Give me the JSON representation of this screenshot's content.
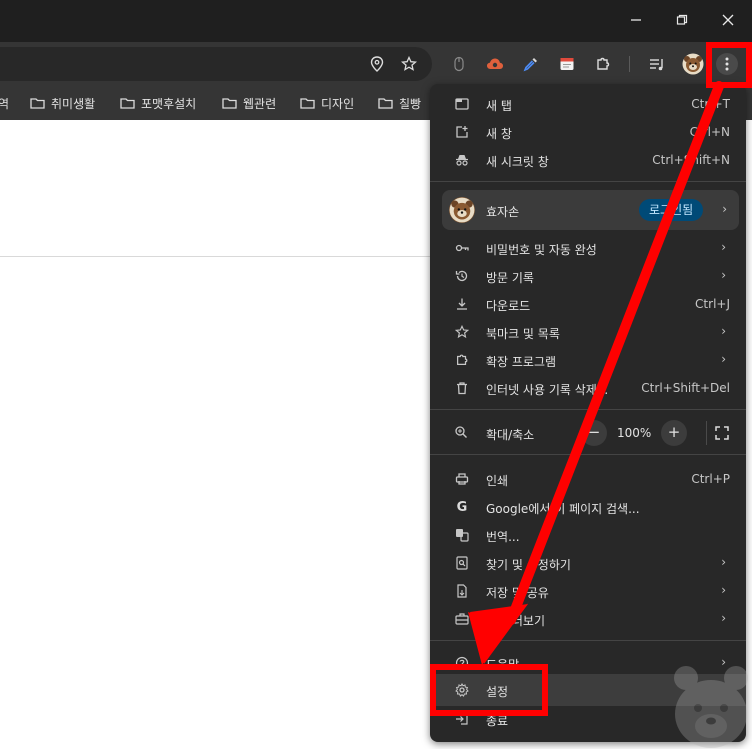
{
  "bookmarks": [
    {
      "label": "역"
    },
    {
      "label": "취미생활"
    },
    {
      "label": "포맷후설치"
    },
    {
      "label": "웹관련"
    },
    {
      "label": "디자인"
    },
    {
      "label": "칠빵"
    }
  ],
  "menu": {
    "items_top": [
      {
        "label": "새 탭",
        "shortcut": "Ctrl+T",
        "icon": "new-tab-icon"
      },
      {
        "label": "새 창",
        "shortcut": "Ctrl+N",
        "icon": "new-window-icon"
      },
      {
        "label": "새 시크릿 창",
        "shortcut": "Ctrl+Shift+N",
        "icon": "incognito-icon"
      }
    ],
    "profile": {
      "name": "효자손",
      "status": "로그인됨"
    },
    "items_mid": [
      {
        "label": "비밀번호 및 자동 완성",
        "icon": "key-icon"
      },
      {
        "label": "방문 기록",
        "icon": "history-icon"
      },
      {
        "label": "다운로드",
        "shortcut": "Ctrl+J",
        "icon": "download-icon"
      },
      {
        "label": "북마크 및 목록",
        "icon": "star-icon"
      },
      {
        "label": "확장 프로그램",
        "icon": "extension-icon"
      },
      {
        "label": "인터넷 사용 기록 삭제...",
        "shortcut": "Ctrl+Shift+Del",
        "icon": "trash-icon"
      }
    ],
    "zoom": {
      "label": "확대/축소",
      "minus": "−",
      "value": "100%",
      "plus": "+"
    },
    "items_lower": [
      {
        "label": "인쇄",
        "shortcut": "Ctrl+P",
        "icon": "print-icon"
      },
      {
        "label": "Google에서 이 페이지 검색...",
        "icon": "google-icon"
      },
      {
        "label": "번역...",
        "icon": "translate-icon"
      },
      {
        "label": "찾기 및 수정하기",
        "icon": "find-icon"
      },
      {
        "label": "저장 및 공유",
        "icon": "save-share-icon"
      },
      {
        "label": "도구 더보기",
        "icon": "toolbox-icon"
      }
    ],
    "items_bottom": [
      {
        "label": "도움말",
        "icon": "help-icon"
      },
      {
        "label": "설정",
        "icon": "gear-icon"
      },
      {
        "label": "종료",
        "icon": "exit-icon"
      }
    ]
  },
  "colors": {
    "highlight": "#ff0000",
    "menu_bg": "#282828",
    "toolbar_bg": "#353535",
    "badge_bg": "#004a77"
  }
}
